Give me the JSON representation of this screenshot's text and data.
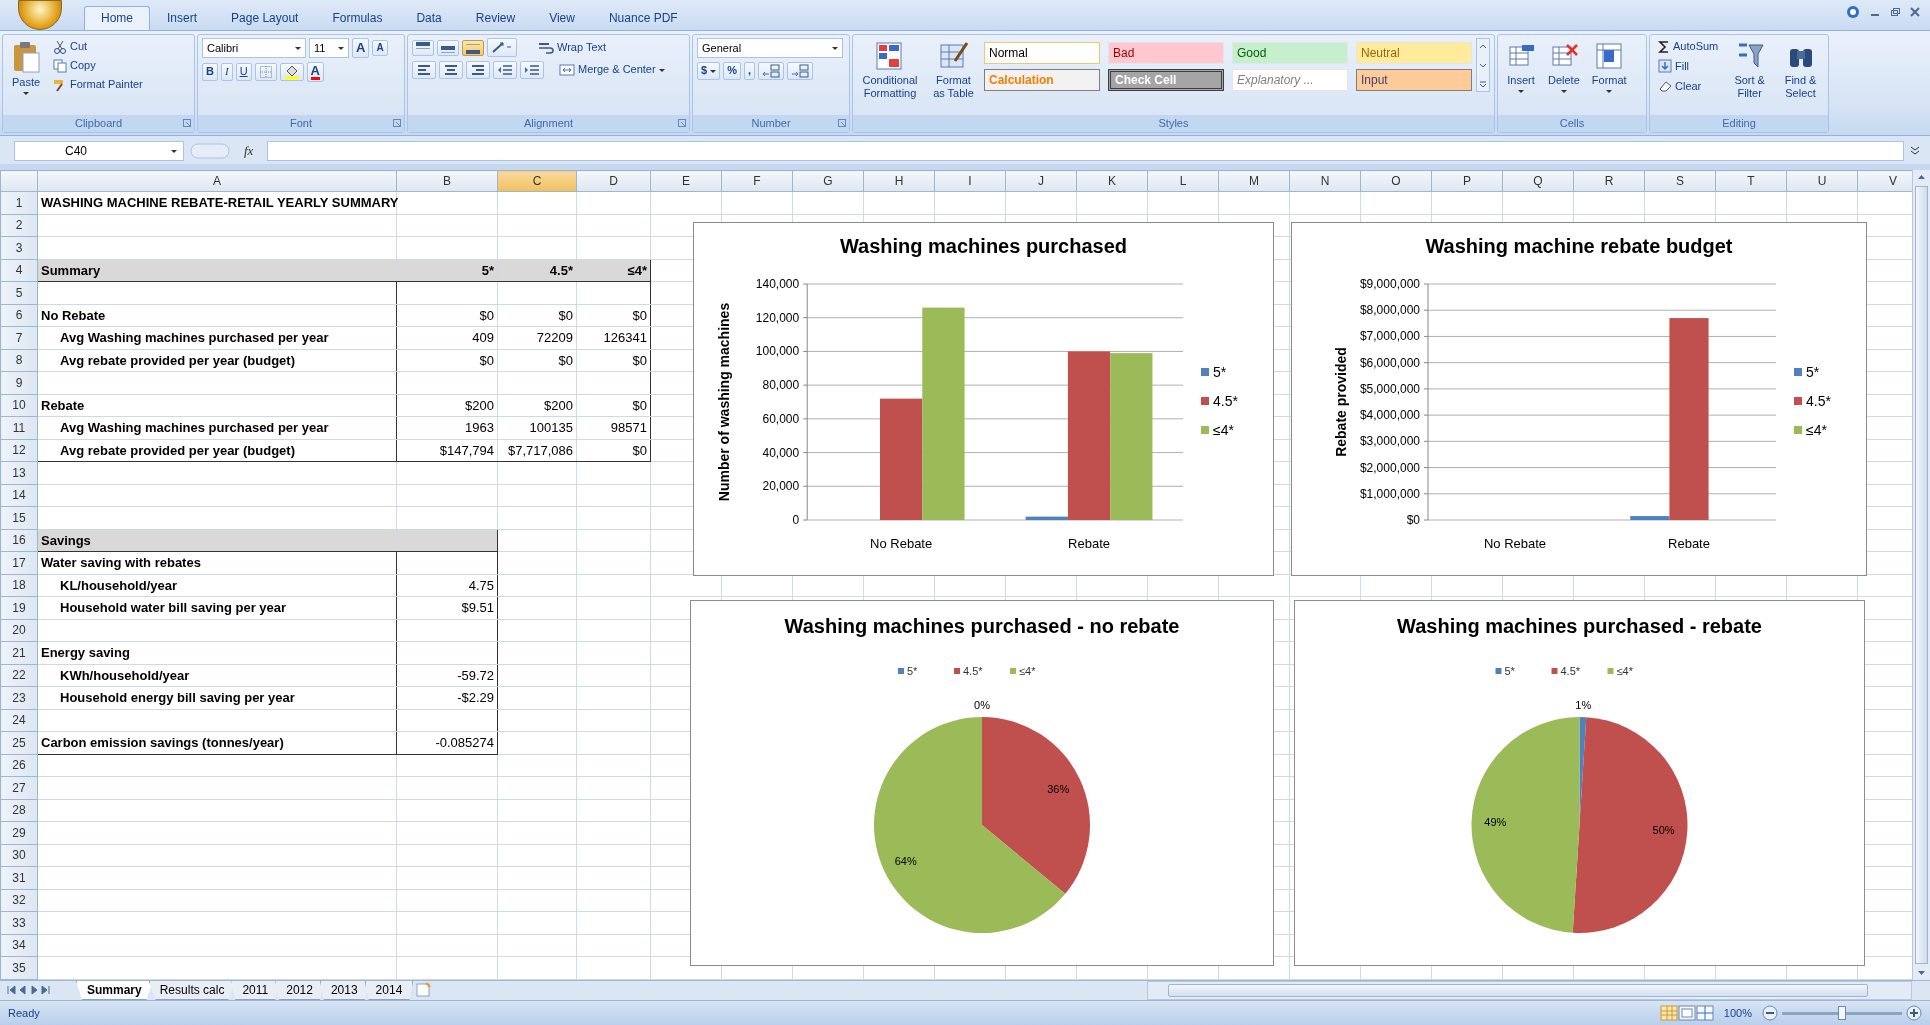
{
  "ribbon": {
    "tabs": [
      {
        "label": "Home",
        "selected": true
      },
      {
        "label": "Insert",
        "selected": false
      },
      {
        "label": "Page Layout",
        "selected": false
      },
      {
        "label": "Formulas",
        "selected": false
      },
      {
        "label": "Data",
        "selected": false
      },
      {
        "label": "Review",
        "selected": false
      },
      {
        "label": "View",
        "selected": false
      },
      {
        "label": "Nuance PDF",
        "selected": false
      }
    ],
    "groups": [
      {
        "kind": "clipboard",
        "label": "Clipboard",
        "paste": "Paste",
        "cut": "Cut",
        "copy": "Copy",
        "format_painter": "Format Painter"
      },
      {
        "kind": "font",
        "label": "Font",
        "font_name": "Calibri",
        "font_size": "11",
        "grow": "A",
        "shrink": "A",
        "bold": "B",
        "italic": "I",
        "underline": "U",
        "font_color": "A"
      },
      {
        "kind": "alignment",
        "label": "Alignment",
        "wrap_text": "Wrap Text",
        "merge": "Merge & Center",
        "vertical_align": [
          {
            "on": false
          },
          {
            "on": false
          },
          {
            "on": true
          }
        ]
      },
      {
        "kind": "number",
        "label": "Number",
        "format": "General",
        "currency": "$",
        "percent": "%",
        "comma": ","
      },
      {
        "kind": "styles",
        "label": "Styles",
        "conditional": "Conditional Formatting",
        "format_table": "Format as Table",
        "cell_styles": [
          {
            "label": "Normal",
            "kind": "normal"
          },
          {
            "label": "Bad",
            "kind": "bad"
          },
          {
            "label": "Good",
            "kind": "good"
          },
          {
            "label": "Neutral",
            "kind": "neutral"
          },
          {
            "label": "Calculation",
            "kind": "calculation"
          },
          {
            "label": "Check Cell",
            "kind": "check"
          },
          {
            "label": "Explanatory ...",
            "kind": "explanatory"
          },
          {
            "label": "Input",
            "kind": "input"
          }
        ]
      },
      {
        "kind": "cells",
        "label": "Cells",
        "buttons": [
          "Insert",
          "Delete",
          "Format"
        ]
      },
      {
        "kind": "editing",
        "label": "Editing",
        "autosum": "AutoSum",
        "fill": "Fill",
        "clear": "Clear",
        "sort": "Sort & Filter",
        "find": "Find & Select"
      }
    ]
  },
  "formula_bar": {
    "name_box": "C40",
    "function_label": "fx"
  },
  "sheet": {
    "columns": [
      {
        "label": "A",
        "selected": false
      },
      {
        "label": "B",
        "selected": false
      },
      {
        "label": "C",
        "selected": true
      },
      {
        "label": "D",
        "selected": false
      },
      {
        "label": "E",
        "selected": false
      },
      {
        "label": "F",
        "selected": false
      },
      {
        "label": "G",
        "selected": false
      },
      {
        "label": "H",
        "selected": false
      },
      {
        "label": "I",
        "selected": false
      },
      {
        "label": "J",
        "selected": false
      },
      {
        "label": "K",
        "selected": false
      },
      {
        "label": "L",
        "selected": false
      },
      {
        "label": "M",
        "selected": false
      },
      {
        "label": "N",
        "selected": false
      },
      {
        "label": "O",
        "selected": false
      },
      {
        "label": "P",
        "selected": false
      },
      {
        "label": "Q",
        "selected": false
      },
      {
        "label": "R",
        "selected": false
      },
      {
        "label": "S",
        "selected": false
      },
      {
        "label": "T",
        "selected": false
      },
      {
        "label": "U",
        "selected": false
      },
      {
        "label": "V",
        "selected": false
      }
    ],
    "rows": [
      {
        "header": "1",
        "kind": "title",
        "a": "WASHING MACHINE REBATE-RETAIL YEARLY SUMMARY"
      },
      {
        "header": "2"
      },
      {
        "header": "3"
      },
      {
        "header": "4",
        "kind": "band",
        "boxed": true,
        "wide": true,
        "a": "Summary",
        "b": "5*",
        "c": "4.5*",
        "d": "≤4*"
      },
      {
        "header": "5",
        "boxed": true,
        "wide": true
      },
      {
        "header": "6",
        "kind": "group",
        "boxed": true,
        "wide": true,
        "a": "No Rebate",
        "b": "$0",
        "c": "$0",
        "d": "$0"
      },
      {
        "header": "7",
        "kind": "detail",
        "boxed": true,
        "wide": true,
        "a": "Avg Washing machines purchased per year",
        "b": "409",
        "c": "72209",
        "d": "126341"
      },
      {
        "header": "8",
        "kind": "detail",
        "boxed": true,
        "wide": true,
        "a": "Avg rebate provided per year (budget)",
        "b": "$0",
        "c": "$0",
        "d": "$0"
      },
      {
        "header": "9",
        "boxed": true,
        "wide": true
      },
      {
        "header": "10",
        "kind": "group",
        "boxed": true,
        "wide": true,
        "a": "Rebate",
        "b": "$200",
        "c": "$200",
        "d": "$0"
      },
      {
        "header": "11",
        "kind": "detail",
        "boxed": true,
        "wide": true,
        "a": "Avg Washing machines purchased per year",
        "b": "1963",
        "c": "100135",
        "d": "98571"
      },
      {
        "header": "12",
        "kind": "detail",
        "boxed": true,
        "wide": true,
        "a": "Avg rebate provided per year (budget)",
        "b": "$147,794",
        "c": "$7,717,086",
        "d": "$0"
      },
      {
        "header": "13"
      },
      {
        "header": "14"
      },
      {
        "header": "15"
      },
      {
        "header": "16",
        "kind": "band",
        "boxed": true,
        "wide": false,
        "a": "Savings"
      },
      {
        "header": "17",
        "kind": "group",
        "boxed": true,
        "wide": false,
        "a": "Water saving with rebates"
      },
      {
        "header": "18",
        "kind": "detail",
        "boxed": true,
        "wide": false,
        "a": "KL/household/year",
        "b": "4.75"
      },
      {
        "header": "19",
        "kind": "detail",
        "boxed": true,
        "wide": false,
        "a": "Household water bill saving per year",
        "b": "$9.51"
      },
      {
        "header": "20",
        "boxed": true,
        "wide": false
      },
      {
        "header": "21",
        "kind": "group",
        "boxed": true,
        "wide": false,
        "a": "Energy saving"
      },
      {
        "header": "22",
        "kind": "detail",
        "boxed": true,
        "wide": false,
        "a": "KWh/household/year",
        "b": "-59.72"
      },
      {
        "header": "23",
        "kind": "detail",
        "boxed": true,
        "wide": false,
        "a": "Household energy bill saving per year",
        "b": "-$2.29"
      },
      {
        "header": "24",
        "boxed": true,
        "wide": false
      },
      {
        "header": "25",
        "kind": "group",
        "boxed": true,
        "wide": false,
        "a": "Carbon emission savings (tonnes/year)",
        "b": "-0.085274"
      },
      {
        "header": "26"
      },
      {
        "header": "27"
      },
      {
        "header": "28"
      },
      {
        "header": "29"
      },
      {
        "header": "30"
      },
      {
        "header": "31"
      },
      {
        "header": "32"
      },
      {
        "header": "33"
      },
      {
        "header": "34"
      },
      {
        "header": "35"
      }
    ]
  },
  "charts": [
    {
      "chart_data": {
        "type": "bar",
        "title": "Washing machines purchased",
        "ylabel": "Number of washing machines",
        "grid": true,
        "legend": "right",
        "categories": [
          "No Rebate",
          "Rebate"
        ],
        "series": [
          {
            "name": "5*",
            "color": "#4f81bd",
            "values": [
              0,
              2000
            ]
          },
          {
            "name": "4.5*",
            "color": "#c0504d",
            "values": [
              72000,
              100000
            ]
          },
          {
            "name": "≤4*",
            "color": "#9bbb59",
            "values": [
              126000,
              99000
            ]
          }
        ],
        "ylim": [
          0,
          140000
        ],
        "yticks": [
          {
            "value": 0,
            "label": "0"
          },
          {
            "value": 20000,
            "label": "20,000"
          },
          {
            "value": 40000,
            "label": "40,000"
          },
          {
            "value": 60000,
            "label": "60,000"
          },
          {
            "value": 80000,
            "label": "80,000"
          },
          {
            "value": 100000,
            "label": "100,000"
          },
          {
            "value": 120000,
            "label": "120,000"
          },
          {
            "value": 140000,
            "label": "140,000"
          }
        ]
      }
    },
    {
      "chart_data": {
        "type": "bar",
        "title": "Washing machine rebate budget",
        "ylabel": "Rebate provided",
        "grid": true,
        "legend": "right",
        "categories": [
          "No Rebate",
          "Rebate"
        ],
        "series": [
          {
            "name": "5*",
            "color": "#4f81bd",
            "values": [
              0,
              150000
            ]
          },
          {
            "name": "4.5*",
            "color": "#c0504d",
            "values": [
              0,
              7700000
            ]
          },
          {
            "name": "≤4*",
            "color": "#9bbb59",
            "values": [
              0,
              0
            ]
          }
        ],
        "ylim": [
          0,
          9000000
        ],
        "yticks": [
          {
            "value": 0,
            "label": "$0"
          },
          {
            "value": 1000000,
            "label": "$1,000,000"
          },
          {
            "value": 2000000,
            "label": "$2,000,000"
          },
          {
            "value": 3000000,
            "label": "$3,000,000"
          },
          {
            "value": 4000000,
            "label": "$4,000,000"
          },
          {
            "value": 5000000,
            "label": "$5,000,000"
          },
          {
            "value": 6000000,
            "label": "$6,000,000"
          },
          {
            "value": 7000000,
            "label": "$7,000,000"
          },
          {
            "value": 8000000,
            "label": "$8,000,000"
          },
          {
            "value": 9000000,
            "label": "$9,000,000"
          }
        ]
      }
    },
    {
      "chart_data": {
        "type": "pie",
        "title": "Washing machines purchased - no rebate",
        "legend": "top",
        "categories": [
          "5*",
          "4.5*",
          "≤4*"
        ],
        "values": [
          0,
          36,
          64
        ],
        "value_labels": [
          "0%",
          "36%",
          "64%"
        ]
      }
    },
    {
      "chart_data": {
        "type": "pie",
        "title": "Washing machines purchased - rebate",
        "legend": "top",
        "categories": [
          "5*",
          "4.5*",
          "≤4*"
        ],
        "values": [
          1,
          50,
          49
        ],
        "value_labels": [
          "1%",
          "50%",
          "49%"
        ]
      }
    }
  ],
  "sheet_tabs": [
    {
      "label": "Summary",
      "selected": true
    },
    {
      "label": "Results calc",
      "selected": false
    },
    {
      "label": "2011",
      "selected": false
    },
    {
      "label": "2012",
      "selected": false
    },
    {
      "label": "2013",
      "selected": false
    },
    {
      "label": "2014",
      "selected": false
    }
  ],
  "status_bar": {
    "status": "Ready",
    "zoom": "100%",
    "zoom_slider": {
      "level": 0.5
    }
  }
}
